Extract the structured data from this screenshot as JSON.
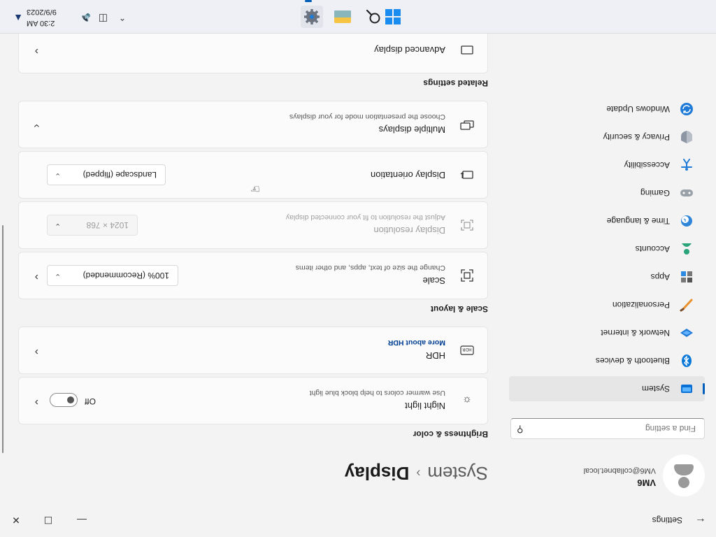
{
  "window": {
    "title": "Settings"
  },
  "account": {
    "name": "VM6",
    "email": "VM6@collabnet.local"
  },
  "search": {
    "placeholder": "Find a setting"
  },
  "nav": {
    "items": [
      {
        "label": "System",
        "icon": "system-icon"
      },
      {
        "label": "Bluetooth & devices",
        "icon": "bluetooth-icon"
      },
      {
        "label": "Network & internet",
        "icon": "network-icon"
      },
      {
        "label": "Personalization",
        "icon": "brush-icon"
      },
      {
        "label": "Apps",
        "icon": "apps-icon"
      },
      {
        "label": "Accounts",
        "icon": "accounts-icon"
      },
      {
        "label": "Time & language",
        "icon": "globe-icon"
      },
      {
        "label": "Gaming",
        "icon": "gaming-icon"
      },
      {
        "label": "Accessibility",
        "icon": "accessibility-icon"
      },
      {
        "label": "Privacy & security",
        "icon": "shield-icon"
      },
      {
        "label": "Windows Update",
        "icon": "update-icon"
      }
    ],
    "active": "System"
  },
  "breadcrumb": {
    "parent": "System",
    "current": "Display"
  },
  "sections": {
    "brightness": "Brightness & color",
    "scale": "Scale & layout",
    "related": "Related settings"
  },
  "night_light": {
    "title": "Night light",
    "subtitle": "Use warmer colors to help block blue light",
    "state": "Off"
  },
  "hdr": {
    "title": "HDR",
    "link": "More about HDR"
  },
  "scale": {
    "title": "Scale",
    "subtitle": "Change the size of text, apps, and other items",
    "value": "100% (Recommended)"
  },
  "resolution": {
    "title": "Display resolution",
    "subtitle": "Adjust the resolution to fit your connected display",
    "value": "1024 × 768"
  },
  "orientation": {
    "title": "Display orientation",
    "value": "Landscape (flipped)"
  },
  "multiple": {
    "title": "Multiple displays",
    "subtitle": "Choose the presentation mode for your displays"
  },
  "advanced": {
    "title": "Advanced display"
  },
  "tray": {
    "time": "2:30 AM",
    "date": "9/9/2023"
  },
  "colors": {
    "accent": "#005fb8",
    "background": "#f3f3f3",
    "card": "#fbfbfb"
  }
}
